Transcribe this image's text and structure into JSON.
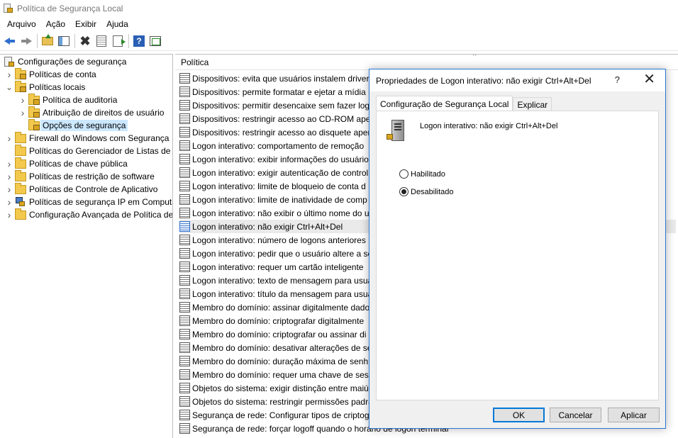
{
  "window": {
    "title": "Política de Segurança Local"
  },
  "menu": [
    "Arquivo",
    "Ação",
    "Exibir",
    "Ajuda"
  ],
  "toolbar_icons": [
    "back-arrow-icon",
    "forward-arrow-icon",
    "folder-up-icon",
    "show-hide-pane-icon",
    "delete-icon",
    "properties-icon",
    "export-list-icon",
    "help-icon",
    "view-icon"
  ],
  "tree": {
    "root": "Configurações de segurança",
    "items": [
      {
        "label": "Políticas de conta",
        "level": 1,
        "expand": "collapsed",
        "icon": "lock-folder-icon"
      },
      {
        "label": "Políticas locais",
        "level": 1,
        "expand": "expanded",
        "icon": "lock-folder-icon"
      },
      {
        "label": "Política de auditoria",
        "level": 2,
        "expand": "collapsed",
        "icon": "lock-folder-icon"
      },
      {
        "label": "Atribuição de direitos de usuário",
        "level": 2,
        "expand": "collapsed",
        "icon": "lock-folder-icon"
      },
      {
        "label": "Opções de segurança",
        "level": 2,
        "expand": "none",
        "icon": "lock-folder-icon",
        "selected": true
      },
      {
        "label": "Firewall do Windows com Segurança",
        "level": 1,
        "expand": "collapsed",
        "icon": "folder-icon"
      },
      {
        "label": "Políticas do Gerenciador de Listas de Rede",
        "level": 1,
        "expand": "none",
        "icon": "folder-icon"
      },
      {
        "label": "Políticas de chave pública",
        "level": 1,
        "expand": "collapsed",
        "icon": "folder-icon"
      },
      {
        "label": "Políticas de restrição de software",
        "level": 1,
        "expand": "collapsed",
        "icon": "folder-icon"
      },
      {
        "label": "Políticas de Controle de Aplicativo",
        "level": 1,
        "expand": "collapsed",
        "icon": "folder-icon"
      },
      {
        "label": "Políticas de segurança IP em Computador Local",
        "level": 1,
        "expand": "collapsed",
        "icon": "ipsec-icon"
      },
      {
        "label": "Configuração Avançada de Política de Auditoria",
        "level": 1,
        "expand": "collapsed",
        "icon": "folder-icon"
      }
    ]
  },
  "list": {
    "header": "Política",
    "rows": [
      "Dispositivos: evita que usuários instalem drivers",
      "Dispositivos: permite formatar e ejetar a mídia r",
      "Dispositivos: permitir desencaixe sem fazer logo",
      "Dispositivos: restringir acesso ao CD-ROM apen",
      "Dispositivos: restringir acesso ao disquete apena",
      "Logon interativo: comportamento de remoção",
      "Logon interativo: exibir informações do usuário",
      "Logon interativo: exigir autenticação de control",
      "Logon interativo: limite de bloqueio de conta d",
      "Logon interativo: limite de inatividade de comp",
      "Logon interativo: não exibir o último nome do u",
      "Logon interativo: não exigir Ctrl+Alt+Del",
      "Logon interativo: número de logons anteriores",
      "Logon interativo: pedir que o usuário altere a se",
      "Logon interativo: requer um cartão inteligente",
      "Logon interativo: texto de mensagem para usuá",
      "Logon interativo: título da mensagem para usuá",
      "Membro do domínio: assinar digitalmente dado",
      "Membro do domínio: criptografar digitalmente",
      "Membro do domínio: criptografar ou assinar di",
      "Membro do domínio: desativar alterações de se",
      "Membro do domínio: duração máxima de senh",
      "Membro do domínio: requer uma chave de sess",
      "Objetos do sistema: exigir distinção entre maiús",
      "Objetos do sistema: restringir permissões padrã",
      "Segurança de rede: Configurar tipos de criptogr",
      "Segurança de rede: forçar logoff quando o horário de logon terminar"
    ],
    "selected_index": 11
  },
  "dialog": {
    "title": "Propriedades de Logon interativo: não exigir Ctrl+Alt+Del",
    "help_glyph": "?",
    "close_glyph": "✕",
    "tabs": [
      "Configuração de Segurança Local",
      "Explicar"
    ],
    "active_tab": 0,
    "policy_name": "Logon interativo: não exigir Ctrl+Alt+Del",
    "options": [
      {
        "label": "Habilitado",
        "checked": false
      },
      {
        "label": "Desabilitado",
        "checked": true
      }
    ],
    "buttons": {
      "ok": "OK",
      "cancel": "Cancelar",
      "apply": "Aplicar"
    }
  }
}
